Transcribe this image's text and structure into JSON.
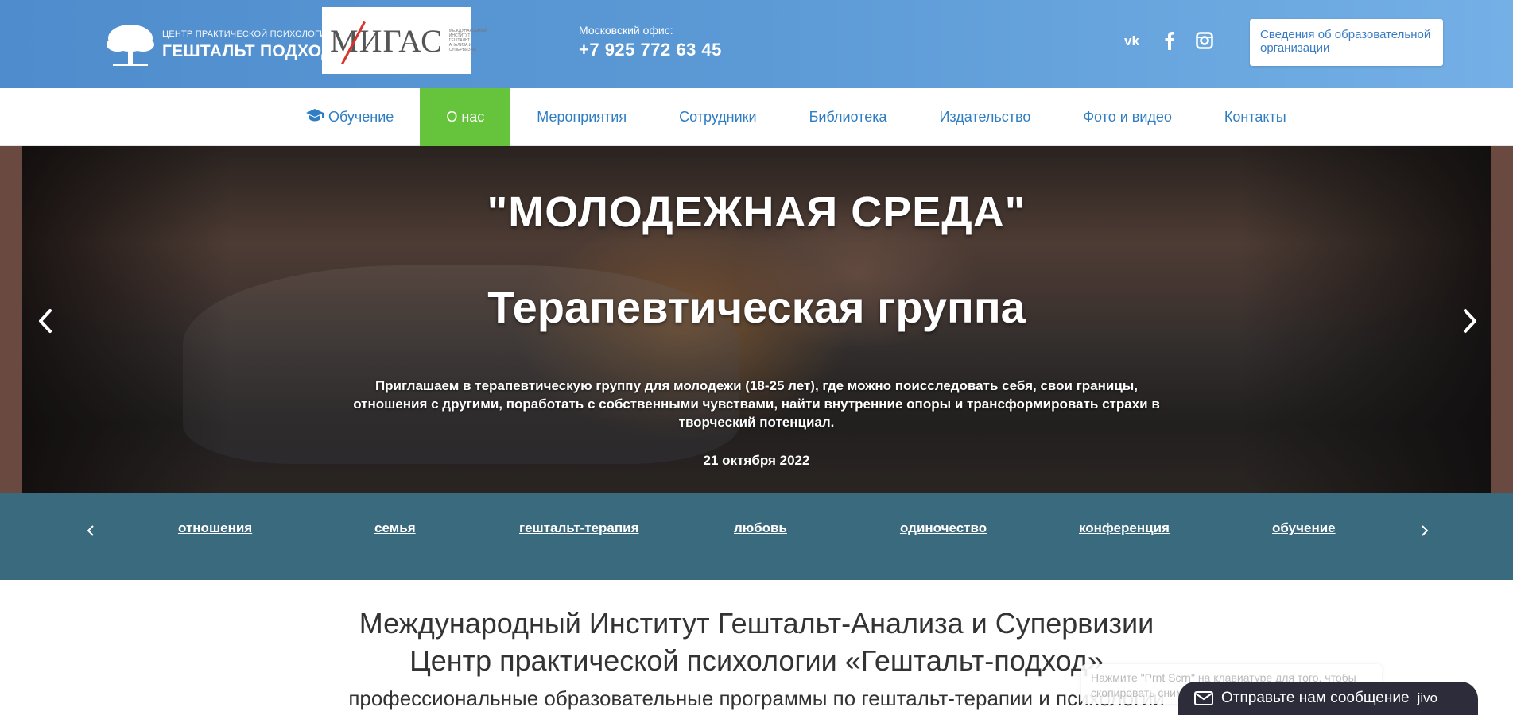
{
  "header": {
    "logo_small": "ЦЕНТР ПРАКТИЧЕСКОЙ ПСИХОЛОГИИ",
    "logo_big": "ГЕШТАЛЬТ ПОДХОД",
    "partner_logo_text": "МИГАС",
    "partner_logo_sub": "МЕЖДУНАРОДНЫЙ ИНСТИТУТ ГЕШТАЛЬТ АНАЛИЗА И СУПЕРВИЗИИ",
    "office_label": "Московский офис:",
    "office_phone": "+7 925 772 63 45",
    "social_icons": [
      "vk-icon",
      "facebook-icon",
      "instagram-icon"
    ],
    "info_button": "Сведения об образовательной организации"
  },
  "nav": {
    "items": [
      {
        "label": "Обучение",
        "icon": "graduation-cap-icon"
      },
      {
        "label": "О нас",
        "active": true
      },
      {
        "label": "Мероприятия"
      },
      {
        "label": "Сотрудники"
      },
      {
        "label": "Библиотека"
      },
      {
        "label": "Издательство"
      },
      {
        "label": "Фото и видео"
      },
      {
        "label": "Контакты"
      }
    ]
  },
  "hero": {
    "title1": "\"МОЛОДЕЖНАЯ СРЕДА\"",
    "title2": "Терапевтическая группа",
    "description": "Приглашаем в терапевтическую группу для молодежи (18-25 лет), где можно поисследовать себя, свои границы, отношения с другими, поработать с собственными чувствами, найти внутренние опоры и трансформировать страхи в творческий потенциал.",
    "date": "21  октября 2022"
  },
  "tags": {
    "items": [
      "отношения",
      "семья",
      "гештальт-терапия",
      "любовь",
      "одиночество",
      "конференция",
      "обучение"
    ]
  },
  "intro": {
    "line1": "Международный Институт Гештальт-Анализа и Супервизии",
    "line2": "Центр практической психологии «Гештальт-подход»",
    "line3": "профессиональные образовательные программы по гештальт-терапии и психологии"
  },
  "widgets": {
    "hint": "Нажмите \"Prnt Scrn\" на клавиатуре для того, чтобы скопировать снимок экрана в буфер обмена",
    "chat_label": "Отправьте нам сообщение",
    "chat_brand": "jivo"
  },
  "colors": {
    "header_blue": "#5c9ad6",
    "nav_link": "#2f7dc2",
    "nav_active": "#66c43c",
    "tags_bar": "#3a6a7e",
    "chat_bg": "#2c2c3a"
  }
}
